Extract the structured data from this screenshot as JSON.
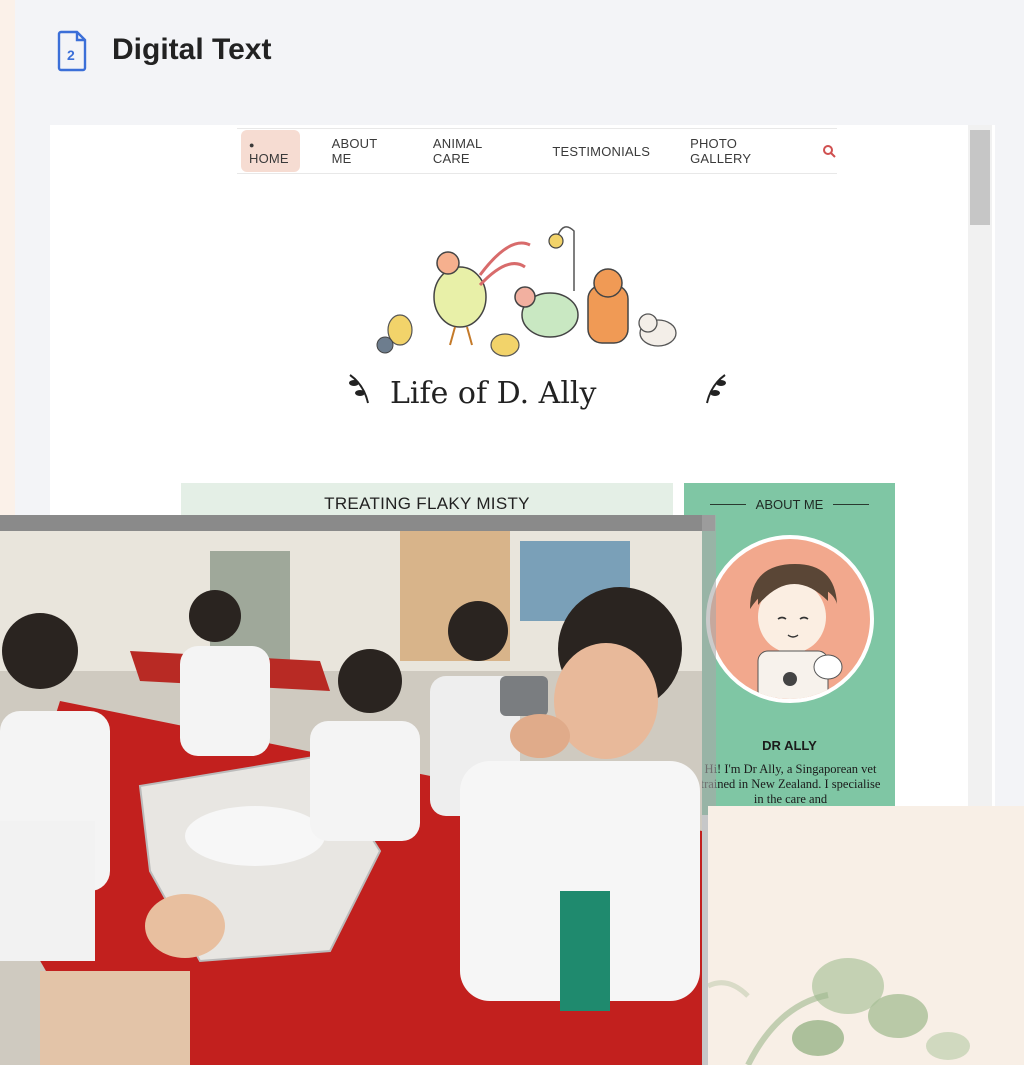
{
  "header": {
    "title": "Digital Text",
    "icon": "document-2-icon"
  },
  "website": {
    "nav": {
      "items": [
        {
          "label": "HOME",
          "active": true
        },
        {
          "label": "ABOUT ME",
          "active": false
        },
        {
          "label": "ANIMAL CARE",
          "active": false
        },
        {
          "label": "TESTIMONIALS",
          "active": false
        },
        {
          "label": "PHOTO GALLERY",
          "active": false
        }
      ],
      "search_icon": "search-icon"
    },
    "logo_text": "Life of D. Ally",
    "post_title": "TREATING FLAKY MISTY",
    "sidebar": {
      "heading": "ABOUT ME",
      "name": "DR ALLY",
      "bio": "Hi! I'm Dr Ally, a Singaporean vet trained in New Zealand. I specialise in the care and"
    }
  },
  "colors": {
    "accent_blue": "#3b6fd8",
    "nav_active_bg": "#f6dcd2",
    "sidebar_green": "#7fc6a4",
    "title_bar_green": "#e4efe6",
    "avatar_peach": "#f2a88d"
  }
}
